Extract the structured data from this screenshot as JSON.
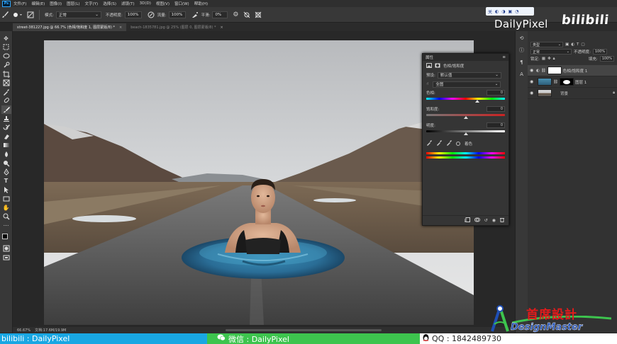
{
  "menu": [
    "文件(F)",
    "编辑(E)",
    "图像(I)",
    "图层(L)",
    "文字(Y)",
    "选择(S)",
    "滤镜(T)",
    "3D(D)",
    "视图(V)",
    "窗口(W)",
    "帮助(H)"
  ],
  "options": {
    "mode_label": "模式:",
    "mode_value": "正常",
    "opacity_label": "不透明度:",
    "opacity_value": "100%",
    "flow_label": "流量:",
    "flow_value": "100%",
    "smooth_label": "平滑:",
    "smooth_value": "0%"
  },
  "tabs": [
    {
      "label": "street-381227.jpg @ 66.7% (色相/饱和度 1, 图层蒙版/8) *",
      "active": true
    },
    {
      "label": "beach-1835781.jpg @ 25% (图层 0, 图层蒙版/8) *",
      "active": false
    }
  ],
  "status": {
    "zoom": "66.67%",
    "doc": "文档:17.6M/19.9M"
  },
  "properties": {
    "title": "属性",
    "adjustment_name": "色相/饱和度",
    "preset_label": "预设:",
    "preset_value": "默认值",
    "range_value": "全图",
    "hue_label": "色相:",
    "hue_value": "0",
    "hue_position": 0.65,
    "saturation_label": "饱和度:",
    "saturation_value": "0",
    "saturation_position": 0.5,
    "lightness_label": "明度:",
    "lightness_value": "0",
    "lightness_position": 0.5,
    "colorize_label": "着色"
  },
  "layers": {
    "filter_value": "类型",
    "blend_value": "正常",
    "opacity_label": "不透明度:",
    "opacity_value": "100%",
    "lock_label": "锁定:",
    "fill_label": "填充:",
    "fill_value": "100%",
    "items": [
      {
        "name": "色相/饱和度 1",
        "selected": true
      },
      {
        "name": "图层 1",
        "selected": false
      },
      {
        "name": "背景",
        "selected": false
      }
    ]
  },
  "watermarks": {
    "top_pill": [
      "关",
      "◐",
      "◑",
      "▣",
      "◔"
    ],
    "brand": "DailyPixel",
    "bilibili": "bilibili",
    "bottom_blue": "bilibili : DailyPixel",
    "bottom_green": "微信 : DailyPixel",
    "bottom_white": "QQ : 1842489730",
    "dm_cn": "首席設計",
    "dm_en": "DesignMaster"
  },
  "colors": {
    "accent": "#31a8ff",
    "bar_blue": "#19a7e3",
    "bar_green": "#3dc44e",
    "dm_red": "#e21b1b",
    "dm_blue": "#1f4fb5"
  }
}
